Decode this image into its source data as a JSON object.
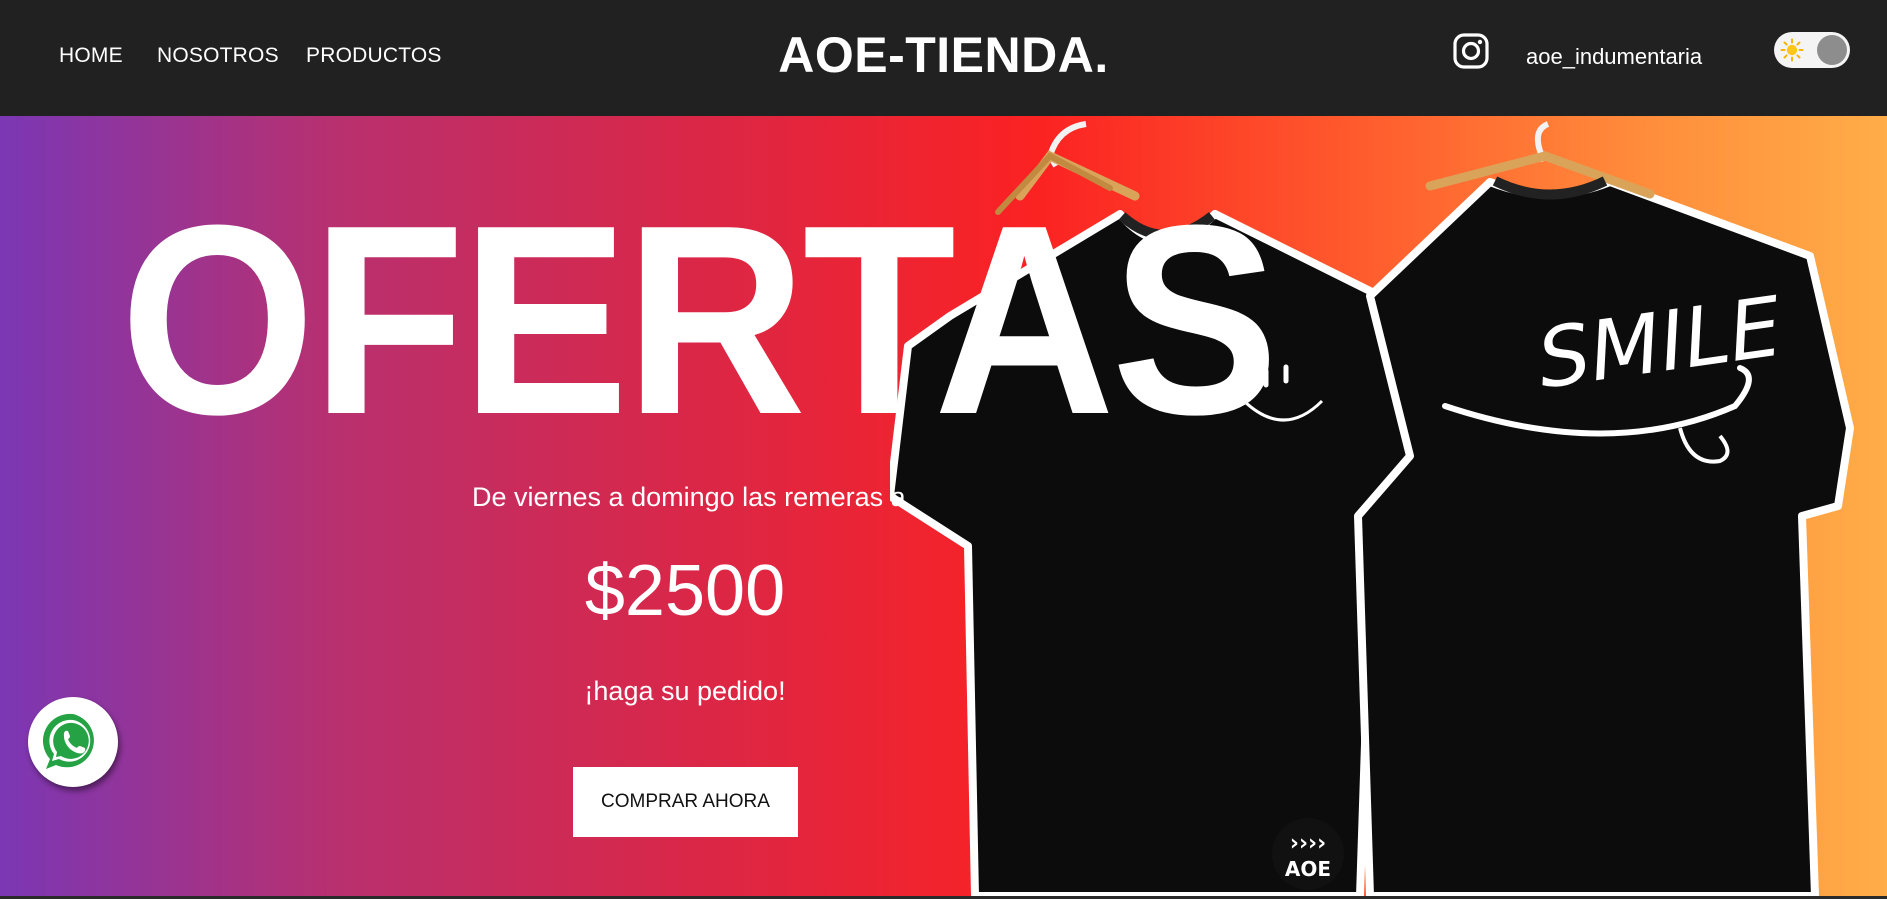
{
  "navbar": {
    "links": [
      {
        "label": "HOME"
      },
      {
        "label": "NOSOTROS"
      },
      {
        "label": "PRODUCTOS"
      }
    ],
    "brand": "AOE-TIENDA.",
    "instagram_handle": "aoe_indumentaria",
    "instagram_icon": "instagram-icon",
    "theme_toggle": {
      "icon": "sun-icon",
      "state": "light"
    }
  },
  "hero": {
    "title": "OFERTAS",
    "subtitle": "De viernes a domingo las remeras a",
    "price": "$2500",
    "call_to_action": "¡haga su pedido!",
    "button_label": "COMPRAR AHORA",
    "shirt_back_print": "SMILE",
    "shirt_logo": "AOE",
    "gradient_colors": [
      "#7b37b4",
      "#dc2645",
      "#fb2222",
      "#ff5b2d",
      "#ffad48"
    ]
  },
  "floating": {
    "whatsapp_icon": "whatsapp-icon"
  },
  "colors": {
    "navbar_bg": "#212121",
    "text": "#ffffff",
    "button_bg": "#ffffff"
  }
}
